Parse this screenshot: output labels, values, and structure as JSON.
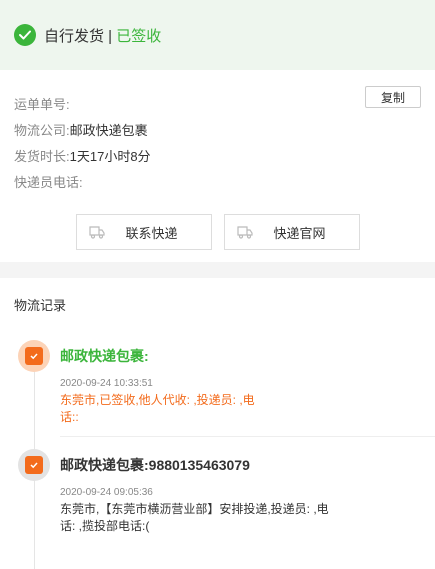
{
  "header": {
    "status_prefix": "自行发货 | ",
    "status": "已签收"
  },
  "info": {
    "copy_label": "复制",
    "rows": [
      {
        "label": "运单单号:",
        "value": ""
      },
      {
        "label": "物流公司:",
        "value": "邮政快递包裹"
      },
      {
        "label": "发货时长:",
        "value": "1天17小时8分"
      },
      {
        "label": "快递员电话:",
        "value": ""
      }
    ],
    "contact_label": "联系快递",
    "website_label": "快递官网"
  },
  "records": {
    "title": "物流记录",
    "entries": [
      {
        "title": "邮政快递包裹:",
        "time": "2020-09-24 10:33:51",
        "desc_line1": "东莞市,已签收,他人代收:          ,投递员:                ,电",
        "desc_line2": "话::"
      },
      {
        "title": "邮政快递包裹:9880135463079",
        "time": "2020-09-24 09:05:36",
        "desc_line1": "东莞市,【东莞市横沥营业部】安排投递,投递员:                 ,电",
        "desc_line2": "话:                        ,揽投部电话:("
      }
    ]
  }
}
